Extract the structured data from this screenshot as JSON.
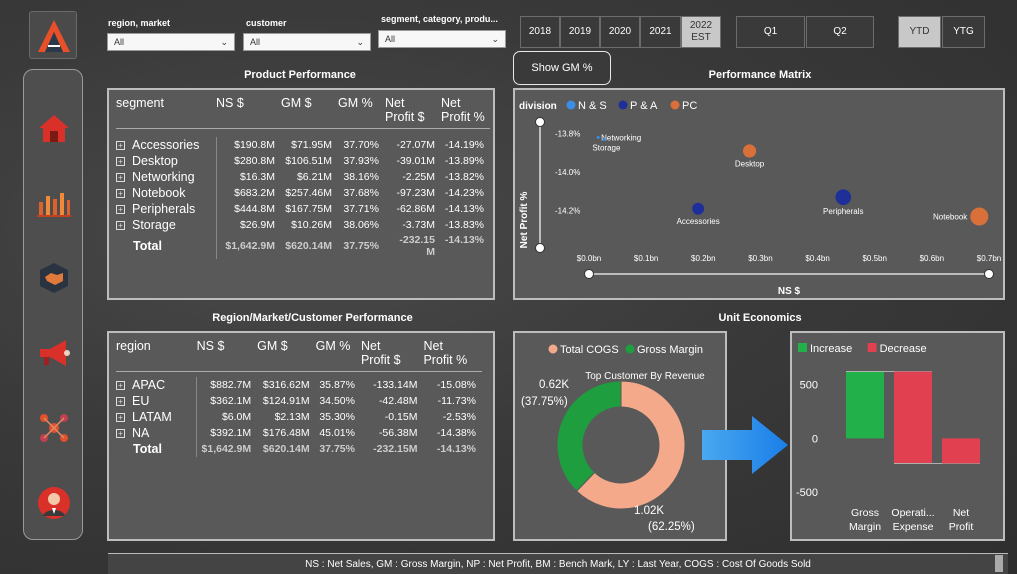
{
  "filters": {
    "region_market": {
      "label": "region, market",
      "value": "All"
    },
    "customer": {
      "label": "customer",
      "value": "All"
    },
    "segment_category_product": {
      "label": "segment, category, produ...",
      "value": "All"
    }
  },
  "years": [
    {
      "label": "2018"
    },
    {
      "label": "2019"
    },
    {
      "label": "2020"
    },
    {
      "label": "2021"
    },
    {
      "label": "2022",
      "sub": "EST"
    }
  ],
  "quarters": [
    "Q1",
    "Q2"
  ],
  "periods": [
    "YTD",
    "YTG"
  ],
  "show_gm_button": "Show GM %",
  "product_performance": {
    "title": "Product Performance",
    "headers": [
      "segment",
      "NS $",
      "GM $",
      "GM %",
      "Net\nProfit $",
      "Net\nProfit %"
    ],
    "rows": [
      [
        "Accessories",
        "$190.8M",
        "$71.95M",
        "37.70%",
        "-27.07M",
        "-14.19%"
      ],
      [
        "Desktop",
        "$280.8M",
        "$106.51M",
        "37.93%",
        "-39.01M",
        "-13.89%"
      ],
      [
        "Networking",
        "$16.3M",
        "$6.21M",
        "38.16%",
        "-2.25M",
        "-13.82%"
      ],
      [
        "Notebook",
        "$683.2M",
        "$257.46M",
        "37.68%",
        "-97.23M",
        "-14.23%"
      ],
      [
        "Peripherals",
        "$444.8M",
        "$167.75M",
        "37.71%",
        "-62.86M",
        "-14.13%"
      ],
      [
        "Storage",
        "$26.9M",
        "$10.26M",
        "38.06%",
        "-3.73M",
        "-13.83%"
      ]
    ],
    "total": [
      "Total",
      "$1,642.9M",
      "$620.14M",
      "37.75%",
      "-232.15\nM",
      "-14.13%"
    ]
  },
  "region_performance": {
    "title": "Region/Market/Customer Performance",
    "headers": [
      "region",
      "NS $",
      "GM $",
      "GM %",
      "Net\nProfit $",
      "Net\nProfit %"
    ],
    "rows": [
      [
        "APAC",
        "$882.7M",
        "$316.62M",
        "35.87%",
        "-133.14M",
        "-15.08%"
      ],
      [
        "EU",
        "$362.1M",
        "$124.91M",
        "34.50%",
        "-42.48M",
        "-11.73%"
      ],
      [
        "LATAM",
        "$6.0M",
        "$2.13M",
        "35.30%",
        "-0.15M",
        "-2.53%"
      ],
      [
        "NA",
        "$392.1M",
        "$176.48M",
        "45.01%",
        "-56.38M",
        "-14.38%"
      ]
    ],
    "total": [
      "Total",
      "$1,642.9M",
      "$620.14M",
      "37.75%",
      "-232.15M",
      "-14.13%"
    ]
  },
  "performance_matrix": {
    "title": "Performance Matrix",
    "legend_title": "division",
    "legend": [
      {
        "name": "N & S",
        "color": "#3a8ee6"
      },
      {
        "name": "P & A",
        "color": "#1f2f9a"
      },
      {
        "name": "PC",
        "color": "#d9703a"
      }
    ],
    "xlabel": "NS $",
    "ylabel": "Net Profit %",
    "x_ticks": [
      "$0.0bn",
      "$0.1bn",
      "$0.2bn",
      "$0.3bn",
      "$0.4bn",
      "$0.5bn",
      "$0.6bn",
      "$0.7bn"
    ],
    "y_ticks": [
      "-13.8%",
      "-14.0%",
      "-14.2%"
    ]
  },
  "chart_data": [
    {
      "type": "scatter",
      "title": "Performance Matrix",
      "xlabel": "NS $",
      "ylabel": "Net Profit %",
      "xlim": [
        0,
        0.7
      ],
      "ylim": [
        -14.3,
        -13.75
      ],
      "points": [
        {
          "label": "Networking",
          "x": 0.016,
          "y": -13.82,
          "size": 1,
          "color": "#3a8ee6"
        },
        {
          "label": "Storage",
          "x": 0.027,
          "y": -13.83,
          "size": 1,
          "color": "#3a8ee6"
        },
        {
          "label": "Desktop",
          "x": 0.281,
          "y": -13.89,
          "size": 6,
          "color": "#d9703a"
        },
        {
          "label": "Accessories",
          "x": 0.191,
          "y": -14.19,
          "size": 5,
          "color": "#1f2f9a"
        },
        {
          "label": "Peripherals",
          "x": 0.445,
          "y": -14.13,
          "size": 8,
          "color": "#1f2f9a"
        },
        {
          "label": "Notebook",
          "x": 0.683,
          "y": -14.23,
          "size": 10,
          "color": "#d9703a"
        }
      ]
    },
    {
      "type": "pie",
      "title": "Top Customer By Revenue",
      "legend": [
        {
          "name": "Total COGS",
          "color": "#f4a98a"
        },
        {
          "name": "Gross Margin",
          "color": "#1e9e3e"
        }
      ],
      "slices": [
        {
          "name": "Total COGS",
          "value": 1.02,
          "label": "1.02K",
          "pct": "(62.25%)"
        },
        {
          "name": "Gross Margin",
          "value": 0.62,
          "label": "0.62K",
          "pct": "(37.75%)"
        }
      ]
    },
    {
      "type": "bar",
      "title": "Unit Economics",
      "legend": [
        {
          "name": "Increase",
          "color": "#22b04b"
        },
        {
          "name": "Decrease",
          "color": "#e04050"
        }
      ],
      "categories": [
        "Gross\nMargin",
        "Operati...\nExpense",
        "Net\nProfit"
      ],
      "waterfall": [
        {
          "start": 0,
          "end": 620,
          "kind": "Increase"
        },
        {
          "start": 620,
          "end": -232,
          "kind": "Decrease"
        },
        {
          "start": -232,
          "end": -232,
          "kind": "Decrease",
          "total": true
        }
      ],
      "y_ticks": [
        "500",
        "0",
        "-500"
      ],
      "ylim": [
        -600,
        700
      ]
    }
  ],
  "unit_economics": {
    "title": "Unit Economics"
  },
  "footer": "NS : Net Sales, GM : Gross Margin, NP : Net Profit, BM : Bench Mark, LY : Last Year, COGS : Cost Of Goods Sold"
}
